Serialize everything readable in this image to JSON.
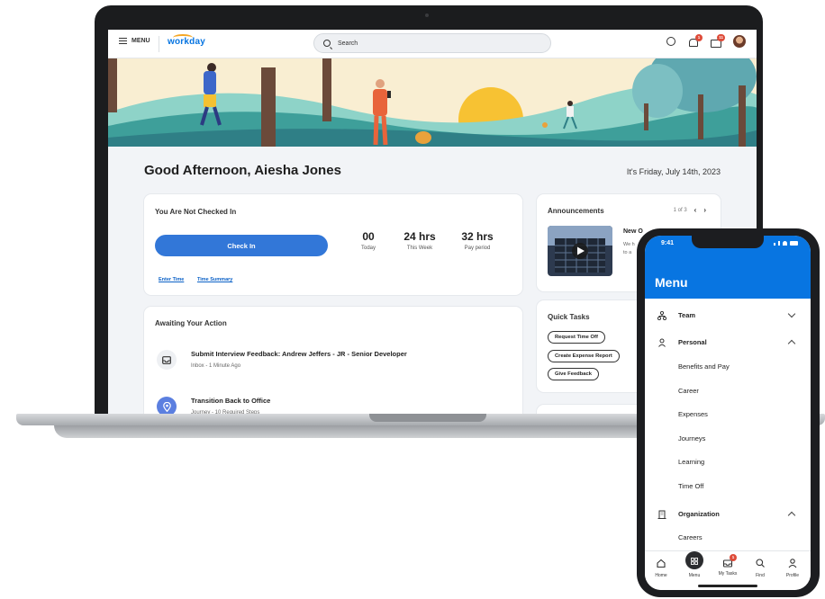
{
  "laptop": {
    "topbar": {
      "menu_label": "MENU",
      "logo_text": "workday",
      "search_placeholder": "Search",
      "notification_badge": "1",
      "inbox_badge": "11"
    },
    "greeting": "Good Afternoon, Aiesha Jones",
    "date": "It's Friday, July 14th, 2023",
    "checkin": {
      "title": "You Are Not Checked In",
      "button": "Check In",
      "stats": [
        {
          "value": "00",
          "label": "Today"
        },
        {
          "value": "24 hrs",
          "label": "This Week"
        },
        {
          "value": "32 hrs",
          "label": "Pay period"
        }
      ],
      "links": [
        "Enter Time",
        "Time Summary"
      ]
    },
    "awaiting": {
      "title": "Awaiting Your Action",
      "items": [
        {
          "title": "Submit Interview Feedback: Andrew Jeffers - JR - Senior Developer",
          "subtitle": "Inbox - 1 Minute Ago",
          "icon": "inbox-icon"
        },
        {
          "title": "Transition Back to Office",
          "subtitle": "Journey - 10 Required Steps",
          "icon": "location-pin-icon"
        }
      ]
    },
    "announcements": {
      "title": "Announcements",
      "pager": "1 of 3",
      "headline": "New O",
      "body_lines": [
        "We h",
        "to a"
      ]
    },
    "quick_tasks": {
      "title": "Quick Tasks",
      "items": [
        "Request Time Off",
        "Create Expense Report",
        "Give Feedback"
      ]
    }
  },
  "phone": {
    "time": "9:41",
    "title": "Menu",
    "sections": [
      {
        "label": "Team",
        "icon": "team-icon",
        "expanded": false
      },
      {
        "label": "Personal",
        "icon": "person-icon",
        "expanded": true
      },
      {
        "label": "Organization",
        "icon": "building-icon",
        "expanded": true
      }
    ],
    "personal_items": [
      "Benefits and Pay",
      "Career",
      "Expenses",
      "Journeys",
      "Learning",
      "Time Off"
    ],
    "organization_items": [
      "Careers"
    ],
    "tabs": [
      {
        "label": "Home",
        "icon": "home-icon"
      },
      {
        "label": "Menu",
        "icon": "grid-icon"
      },
      {
        "label": "My Tasks",
        "icon": "inbox-icon",
        "badge": "1"
      },
      {
        "label": "Find",
        "icon": "search-icon"
      },
      {
        "label": "Profile",
        "icon": "person-icon"
      }
    ]
  },
  "colors": {
    "brand_blue": "#0875e1",
    "button_blue": "#3277d8",
    "badge_red": "#de4b39"
  }
}
